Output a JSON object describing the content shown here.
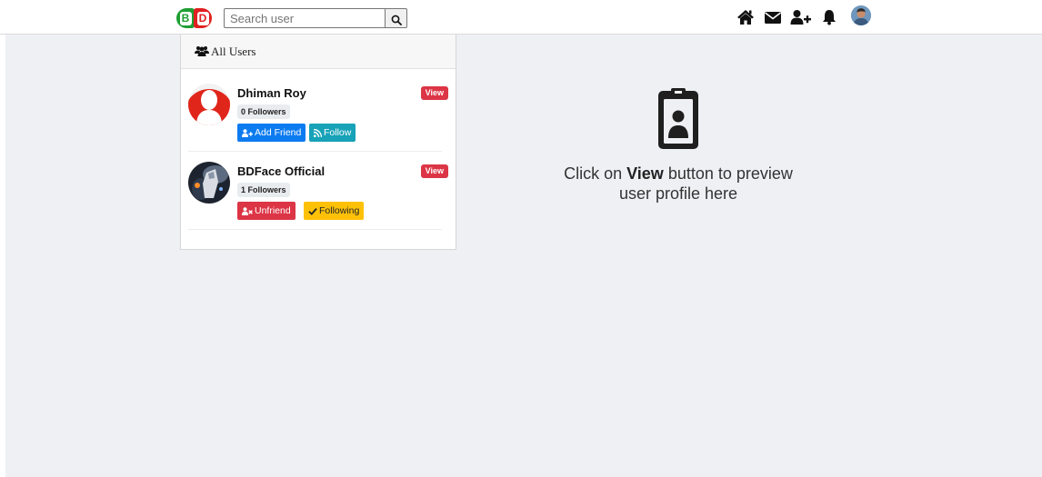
{
  "brand": {
    "logo_left": "B",
    "logo_right": "D",
    "green": "#1e9e33",
    "red": "#e02020"
  },
  "search": {
    "placeholder": "Search user",
    "value": ""
  },
  "nav_icons": [
    "home-icon",
    "envelope-icon",
    "user-plus-icon",
    "bell-icon",
    "avatar"
  ],
  "panel": {
    "title": "All Users"
  },
  "users": [
    {
      "name": "Dhiman Roy",
      "followers": "0 Followers",
      "view_label": "View",
      "actions": [
        {
          "label": "Add Friend",
          "style": "primary",
          "icon": "user-plus-icon"
        },
        {
          "label": "Follow",
          "style": "info",
          "icon": "rss-icon"
        }
      ]
    },
    {
      "name": "BDFace Official",
      "followers": "1 Followers",
      "view_label": "View",
      "actions": [
        {
          "label": "Unfriend",
          "style": "danger",
          "icon": "user-times-icon"
        },
        {
          "label": "Following",
          "style": "warning",
          "icon": "check-icon"
        }
      ]
    }
  ],
  "preview": {
    "msg_prefix": "Click on ",
    "msg_bold": "View",
    "msg_suffix": " button to preview",
    "msg_line2": "user profile here"
  },
  "colors": {
    "primary": "#0d7bf0",
    "info": "#17a2b8",
    "danger": "#dc3545",
    "warning": "#ffc107",
    "background": "#eff0f4"
  }
}
